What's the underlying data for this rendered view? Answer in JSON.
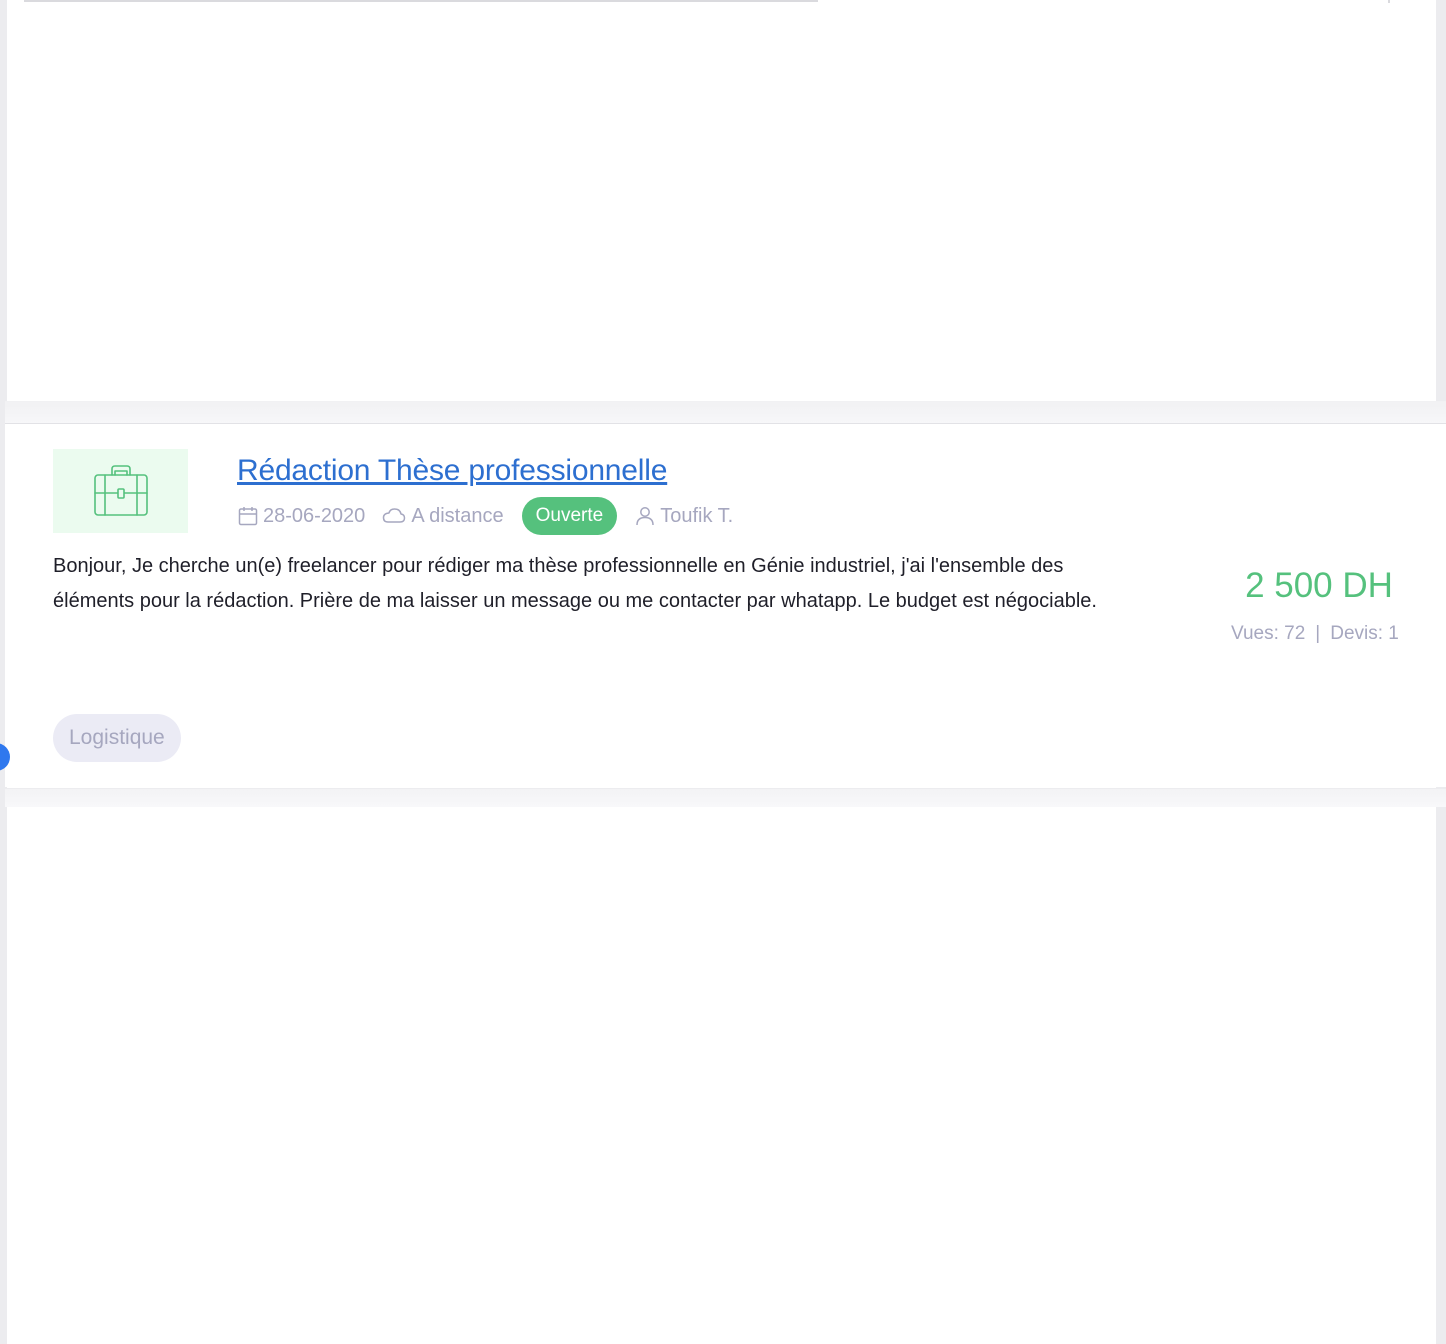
{
  "listing": {
    "title": "Rédaction Thèse professionnelle",
    "date": "28-06-2020",
    "location": "A distance",
    "status": "Ouverte",
    "author": "Toufik T.",
    "description": "Bonjour, Je cherche un(e) freelancer pour rédiger ma thèse professionnelle en Génie industriel, j'ai l'ensemble des éléments pour la rédaction. Prière de ma laisser un message ou me contacter par whatapp. Le budget est négociable.",
    "price": "2 500 DH",
    "views": "Vues: 72",
    "quotes_separator": "|",
    "quotes": "Devis: 1",
    "tag": "Logistique",
    "icon": "briefcase-icon"
  },
  "colors": {
    "accent_green": "#55c17d",
    "link_blue": "#2d6fd0",
    "muted": "#a6a7bf",
    "thumb_bg": "#ebfbef"
  }
}
